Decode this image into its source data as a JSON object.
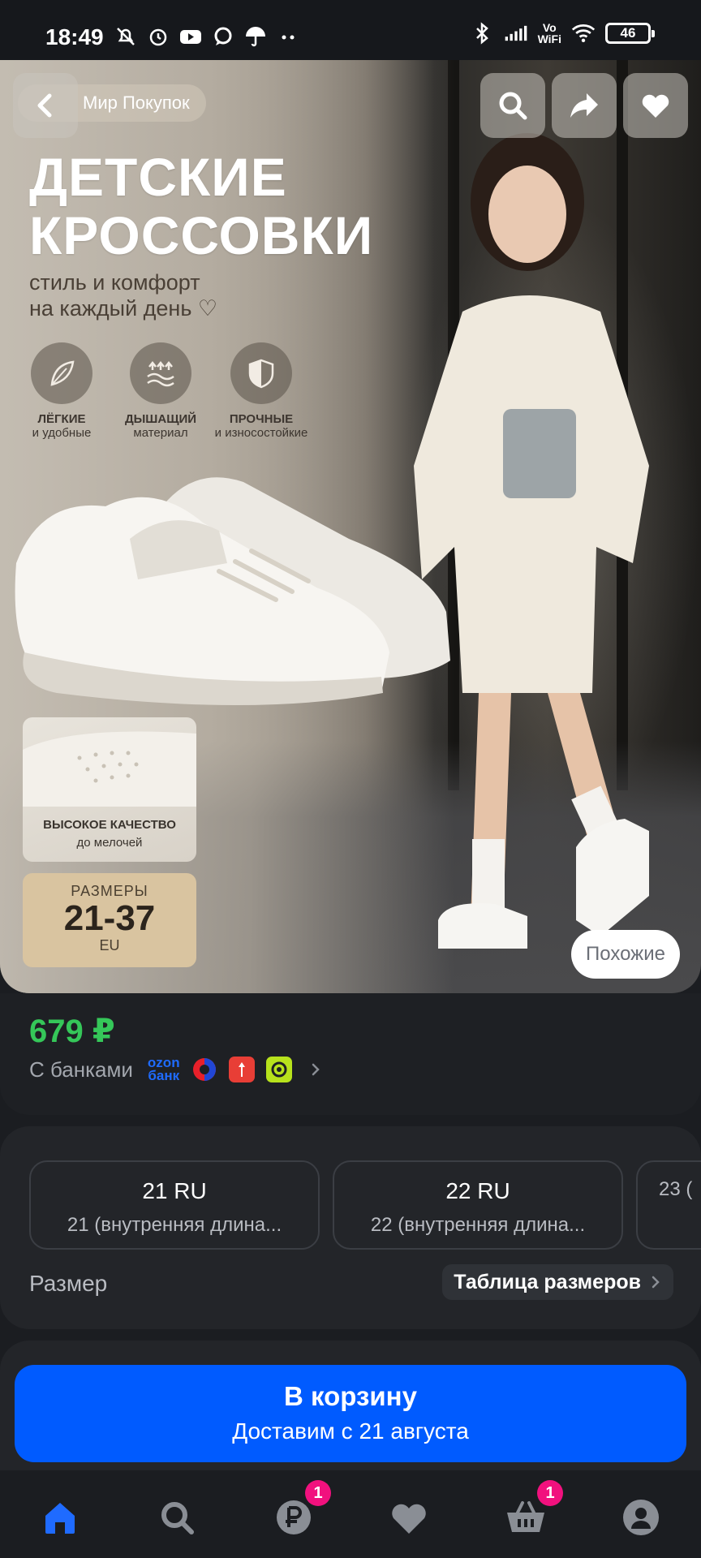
{
  "status_bar": {
    "time": "18:49",
    "vowifi": "Vo\nWiFi",
    "battery": "46",
    "icons": [
      "mute-icon",
      "alarm-icon",
      "youtube-icon",
      "chat-icon",
      "umbrella-icon",
      "more-dots-icon",
      "bluetooth-icon",
      "signal-icon",
      "wifi-icon",
      "battery-icon"
    ]
  },
  "hero": {
    "brand": "Мир Покупок",
    "title_line1": "ДЕТСКИЕ",
    "title_line2": "КРОССОВКИ",
    "subtitle_line1": "стиль и комфорт",
    "subtitle_line2": "на каждый день ♡",
    "features": [
      {
        "label1": "ЛЁГКИЕ",
        "label2": "и удобные",
        "icon": "feather-icon"
      },
      {
        "label1": "ДЫШАЩИЙ",
        "label2": "материал",
        "icon": "airflow-icon"
      },
      {
        "label1": "ПРОЧНЫЕ",
        "label2": "и износостойкие",
        "icon": "shield-icon"
      }
    ],
    "quality_line1": "ВЫСОКОЕ КАЧЕСТВО",
    "quality_line2": "до мелочей",
    "sizes_label": "РАЗМЕРЫ",
    "sizes_range": "21-37",
    "sizes_unit": "EU",
    "similar_button": "Похожие"
  },
  "price": {
    "value": "679 ₽",
    "banks_label": "С банками",
    "ozon_logo": "ozon\nбанк"
  },
  "size": {
    "options": [
      {
        "title": "21 RU",
        "subtitle": "21 (внутренняя длина..."
      },
      {
        "title": "22 RU",
        "subtitle": "22 (внутренняя длина..."
      },
      {
        "title": "",
        "subtitle": "23 ("
      }
    ],
    "label": "Размер",
    "table_button": "Таблица размеров"
  },
  "cart": {
    "title": "В корзину",
    "subtitle": "Доставим с 21 августа"
  },
  "bottom_nav": {
    "items": [
      {
        "icon": "home-icon",
        "badge": ""
      },
      {
        "icon": "search-icon",
        "badge": ""
      },
      {
        "icon": "ruble-icon",
        "badge": "1"
      },
      {
        "icon": "heart-icon",
        "badge": ""
      },
      {
        "icon": "basket-icon",
        "badge": "1"
      },
      {
        "icon": "profile-icon",
        "badge": ""
      }
    ]
  },
  "colors": {
    "accent_blue": "#005bff",
    "price_green": "#35c759",
    "badge_pink": "#f1117e",
    "background": "#1b1d21"
  }
}
